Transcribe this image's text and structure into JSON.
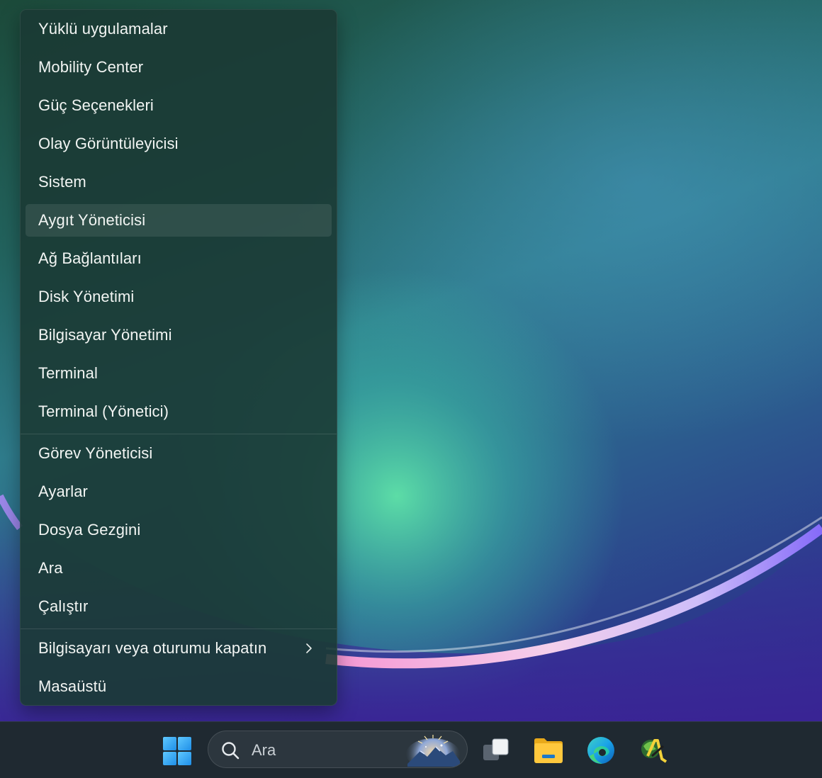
{
  "menu": {
    "group1": [
      {
        "label": "Yüklü uygulamalar"
      },
      {
        "label": "Mobility Center"
      },
      {
        "label": "Güç Seçenekleri"
      },
      {
        "label": "Olay Görüntüleyicisi"
      },
      {
        "label": "Sistem"
      },
      {
        "label": "Aygıt Yöneticisi"
      },
      {
        "label": "Ağ Bağlantıları"
      },
      {
        "label": "Disk Yönetimi"
      },
      {
        "label": "Bilgisayar Yönetimi"
      },
      {
        "label": "Terminal"
      },
      {
        "label": "Terminal (Yönetici)"
      }
    ],
    "group2": [
      {
        "label": "Görev Yöneticisi"
      },
      {
        "label": "Ayarlar"
      },
      {
        "label": "Dosya Gezgini"
      },
      {
        "label": "Ara"
      },
      {
        "label": "Çalıştır"
      }
    ],
    "group3": [
      {
        "label": "Bilgisayarı veya oturumu kapatın",
        "submenu_icon": "chevron-right-icon"
      },
      {
        "label": "Masaüstü"
      }
    ],
    "highlighted_item": "Aygıt Yöneticisi"
  },
  "taskbar": {
    "start_icon": "windows-logo-icon",
    "search": {
      "placeholder": "Ara",
      "icon": "search-icon"
    },
    "pinned": [
      {
        "icon": "task-view-icon"
      },
      {
        "icon": "file-explorer-icon"
      },
      {
        "icon": "edge-icon"
      },
      {
        "icon": "app-icon"
      }
    ]
  },
  "colors": {
    "menu_background": "#1b3a34",
    "menu_text": "#f2f5f3",
    "taskbar_background": "#1f2931",
    "accent_blue": "#3aa0f0"
  }
}
